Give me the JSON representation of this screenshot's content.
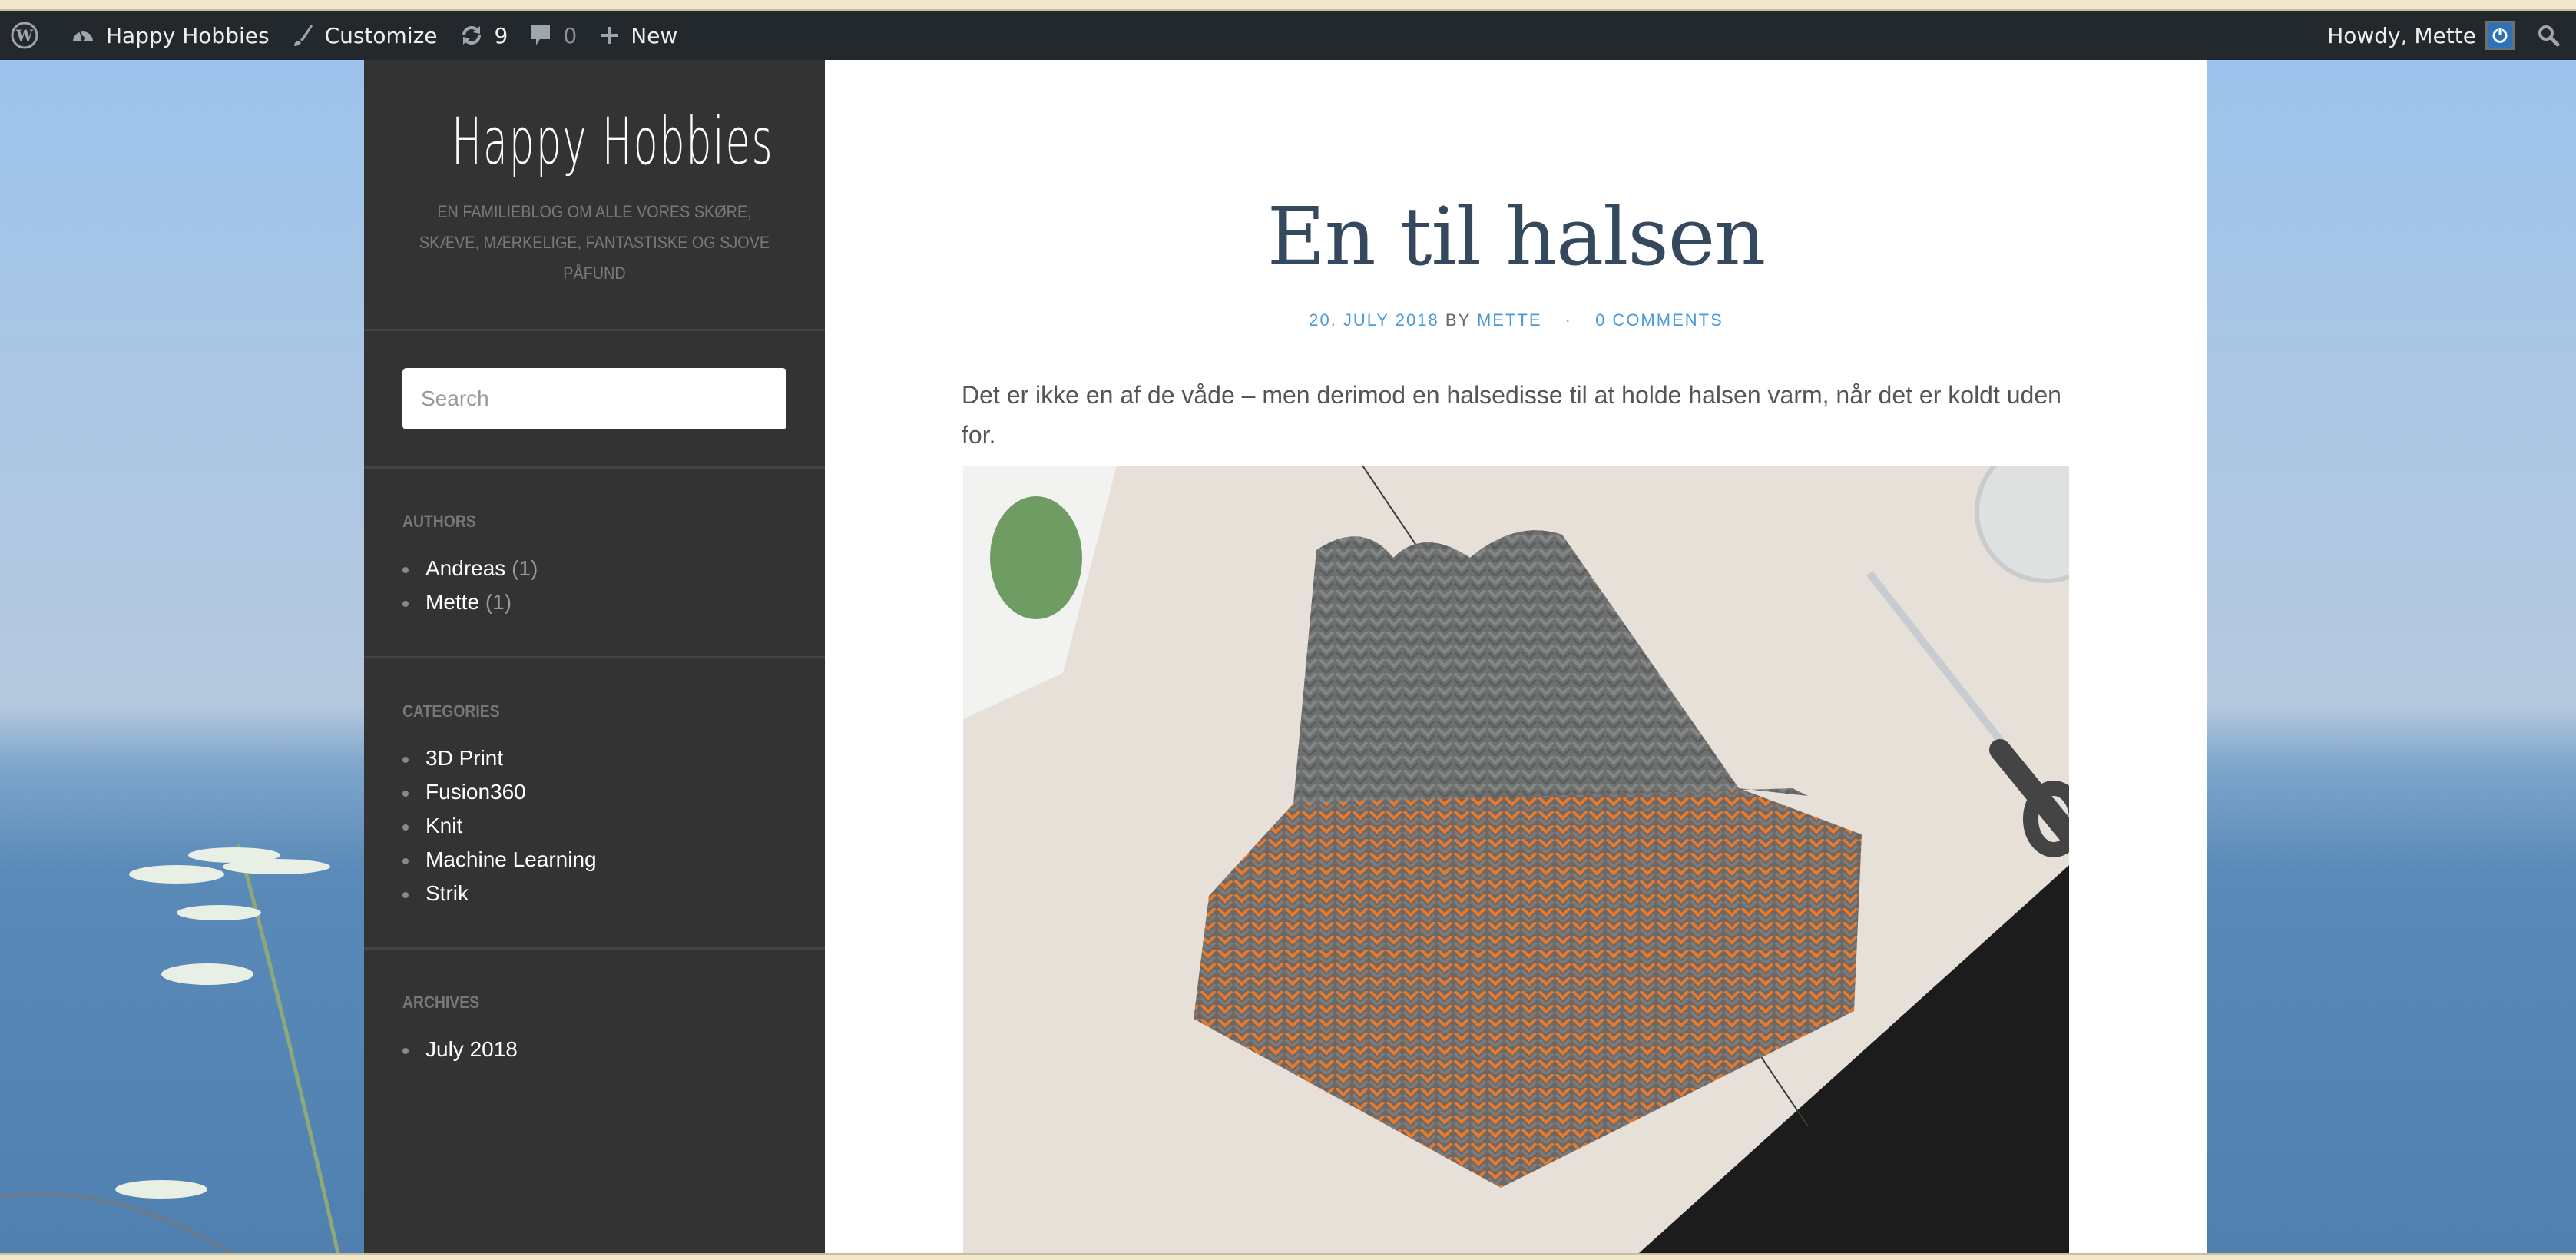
{
  "admin_bar": {
    "wp_logo": "wordpress-icon",
    "site_name": "Happy Hobbies",
    "customize_label": "Customize",
    "updates_count": "9",
    "comments_count": "0",
    "new_label": "New",
    "greeting": "Howdy, Mette",
    "icons": {
      "site": "dashboard-icon",
      "customize": "paintbrush-icon",
      "updates": "refresh-icon",
      "comments": "comment-icon",
      "new": "plus-icon",
      "avatar": "avatar-icon",
      "search": "search-icon"
    }
  },
  "sidebar": {
    "site_title": "Happy Hobbies",
    "site_description": "En familieblog om alle vores skøre, skæve, mærkelige, fantastiske og sjove påfund",
    "search": {
      "placeholder": "Search",
      "value": ""
    },
    "authors": {
      "title": "Authors",
      "items": [
        {
          "label": "Andreas",
          "count": "(1)"
        },
        {
          "label": "Mette",
          "count": "(1)"
        }
      ]
    },
    "categories": {
      "title": "Categories",
      "items": [
        {
          "label": "3D Print"
        },
        {
          "label": "Fusion360"
        },
        {
          "label": "Knit"
        },
        {
          "label": "Machine Learning"
        },
        {
          "label": "Strik"
        }
      ]
    },
    "archives": {
      "title": "Archives",
      "items": [
        {
          "label": "July 2018"
        }
      ]
    }
  },
  "post": {
    "title": "En til halsen",
    "date": "20. July 2018",
    "by": "by",
    "author": "Mette",
    "separator": "·",
    "comments": "0 Comments",
    "body": "Det er ikke en af de våde – men derimod en halsedisse til at holde halsen varm, når det er koldt uden for.",
    "image_alt": "Knitted grey and orange neck warmer on a white table next to scissors"
  },
  "colors": {
    "admin_bar_bg": "#23282d",
    "sidebar_bg": "#333333",
    "title_color": "#34495e",
    "link_color": "#4a9ad6",
    "avatar_bg": "#2e73b8"
  }
}
